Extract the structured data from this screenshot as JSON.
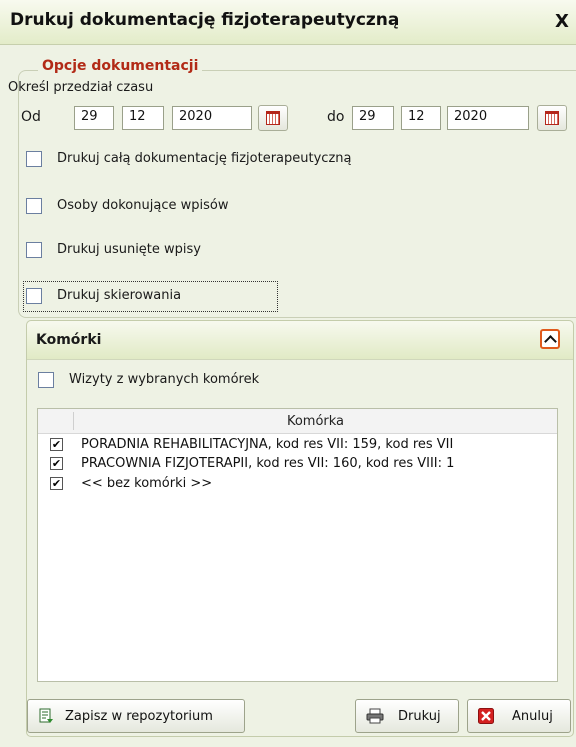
{
  "window": {
    "title": "Drukuj dokumentację fizjoterapeutyczną",
    "close_label": "X"
  },
  "options": {
    "legend": "Opcje dokumentacji",
    "range_label": "Określ przedział czasu",
    "from_label": "Od",
    "to_label": "do",
    "from": {
      "day": "29",
      "month": "12",
      "year": "2020"
    },
    "to": {
      "day": "29",
      "month": "12",
      "year": "2020"
    },
    "checkboxes": [
      {
        "label": "Drukuj całą dokumentację fizjoterapeutyczną",
        "checked": false
      },
      {
        "label": "Osoby dokonujące wpisów",
        "checked": false
      },
      {
        "label": "Drukuj usunięte wpisy",
        "checked": false
      },
      {
        "label": "Drukuj skierowania",
        "checked": false
      }
    ]
  },
  "cells_panel": {
    "title": "Komórki",
    "filter_label": "Wizyty z wybranych komórek",
    "filter_checked": false,
    "column_header": "Komórka",
    "rows": [
      {
        "label": "PORADNIA REHABILITACYJNA, kod res VII: 159, kod res VII",
        "checked": true
      },
      {
        "label": "PRACOWNIA FIZJOTERAPII, kod res VII: 160, kod res VIII: 1",
        "checked": true
      },
      {
        "label": "<< bez komórki >>",
        "checked": true
      }
    ]
  },
  "buttons": {
    "save_repo": "Zapisz w repozytorium",
    "print": "Drukuj",
    "cancel": "Anuluj"
  },
  "colors": {
    "legend": "#b22a16",
    "accent": "#e05a1c",
    "background": "#eef2e4"
  }
}
